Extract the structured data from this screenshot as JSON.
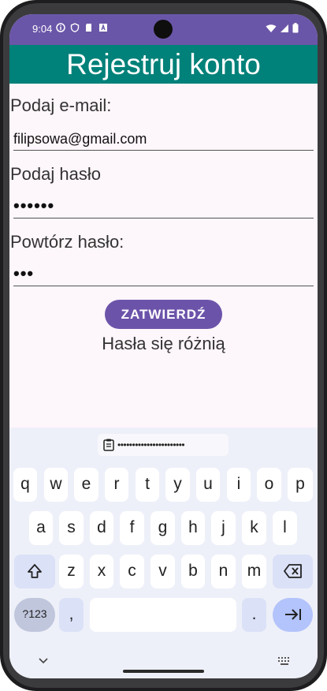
{
  "status": {
    "time": "9:04"
  },
  "app": {
    "title": "Rejestruj konto"
  },
  "form": {
    "email_label": "Podaj e-mail:",
    "email_value": "filipsowa@gmail.com",
    "password_label": "Podaj hasło",
    "password_value": "••••••",
    "repeat_label": "Powtórz hasło:",
    "repeat_value": "•••",
    "confirm_label": "ZATWIERDŹ",
    "error_text": "Hasła się różnią"
  },
  "keyboard": {
    "clipboard_text": "•••••••••••••••••••••••",
    "row1": [
      "q",
      "w",
      "e",
      "r",
      "t",
      "y",
      "u",
      "i",
      "o",
      "p"
    ],
    "row2": [
      "a",
      "s",
      "d",
      "f",
      "g",
      "h",
      "j",
      "k",
      "l"
    ],
    "row3": [
      "z",
      "x",
      "c",
      "v",
      "b",
      "n",
      "m"
    ],
    "symbols_label": "?123",
    "comma": ",",
    "period": "."
  },
  "colors": {
    "statusbar": "#6a56a8",
    "appbar": "#008179",
    "button": "#6c53aa"
  }
}
